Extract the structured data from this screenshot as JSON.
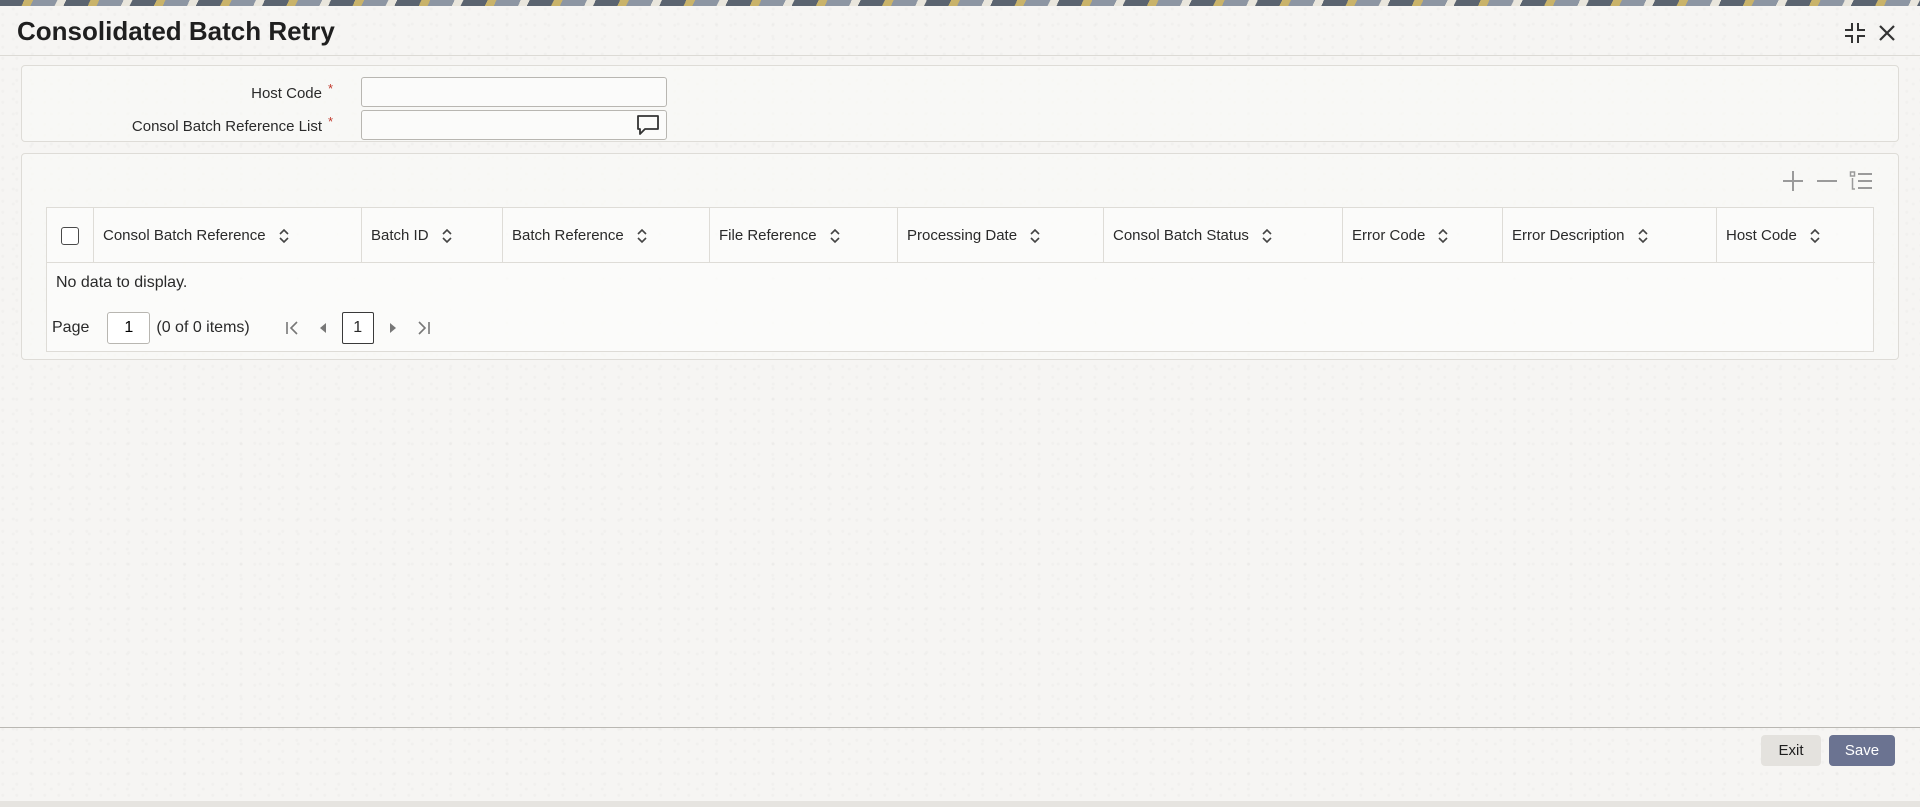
{
  "page": {
    "title": "Consolidated Batch Retry"
  },
  "window_controls": {
    "minimize_icon": "collapse-arrows-icon",
    "close_icon": "close-icon"
  },
  "form": {
    "host_code": {
      "label": "Host Code",
      "required_mark": "*",
      "value": ""
    },
    "consol_batch_reference_list": {
      "label": "Consol Batch Reference List",
      "required_mark": "*",
      "value": ""
    }
  },
  "grid": {
    "columns": [
      "Consol Batch Reference",
      "Batch ID",
      "Batch Reference",
      "File Reference",
      "Processing Date",
      "Consol Batch Status",
      "Error Code",
      "Error Description",
      "Host Code"
    ],
    "empty_message": "No data to display.",
    "pager": {
      "label": "Page",
      "page_value": "1",
      "items_text": "(0 of 0 items)",
      "current_page": "1"
    }
  },
  "footer": {
    "exit_label": "Exit",
    "save_label": "Save"
  },
  "colors": {
    "save_button": "#6b7391",
    "exit_button": "#e4e2de",
    "required": "#c0392b"
  }
}
